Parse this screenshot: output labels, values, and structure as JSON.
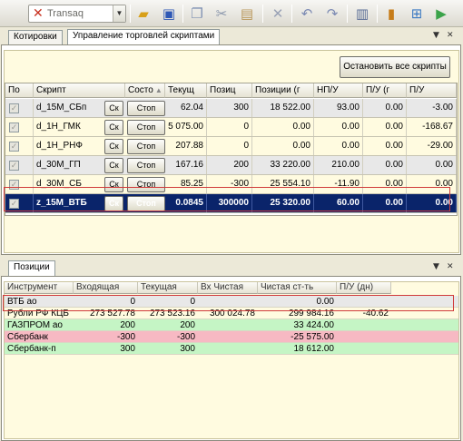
{
  "toolbar": {
    "brand": "Transaq",
    "icons": [
      "open-folder-icon",
      "save-icon",
      "copy-icon",
      "cut-icon",
      "paste-icon",
      "delete-icon",
      "undo-icon",
      "redo-icon",
      "document-icon",
      "chart-icon",
      "tree-icon",
      "play-icon"
    ]
  },
  "tabs_top": [
    "Котировки",
    "Управление торговлей скриптами"
  ],
  "scripts": {
    "stop_all": "Остановить все скрипты",
    "columns": [
      "По",
      "Скрипт",
      "Состо",
      "Текущ",
      "Позиц",
      "Позиции (г",
      "НП/У",
      "П/У (г",
      "П/У"
    ],
    "sk_label": "Ск",
    "stop_label": "Стоп",
    "rows": [
      {
        "name": "d_15M_СБп",
        "cur": "62.04",
        "pos": "300",
        "posv": "18 522.00",
        "npu": "93.00",
        "pug": "0.00",
        "pu": "-3.00"
      },
      {
        "name": "d_1H_ГМК",
        "cur": "5 075.00",
        "pos": "0",
        "posv": "0.00",
        "npu": "0.00",
        "pug": "0.00",
        "pu": "-168.67"
      },
      {
        "name": "d_1H_РНФ",
        "cur": "207.88",
        "pos": "0",
        "posv": "0.00",
        "npu": "0.00",
        "pug": "0.00",
        "pu": "-29.00"
      },
      {
        "name": "d_30M_ГП",
        "cur": "167.16",
        "pos": "200",
        "posv": "33 220.00",
        "npu": "210.00",
        "pug": "0.00",
        "pu": "0.00"
      },
      {
        "name": "d_30M_СБ",
        "cur": "85.25",
        "pos": "-300",
        "posv": "25 554.10",
        "npu": "-11.90",
        "pug": "0.00",
        "pu": "0.00"
      },
      {
        "name": "z_15M_ВТБ",
        "cur": "0.0845",
        "pos": "300000",
        "posv": "25 320.00",
        "npu": "60.00",
        "pug": "0.00",
        "pu": "0.00"
      }
    ]
  },
  "positions": {
    "tab": "Позиции",
    "columns": [
      "Инструмент",
      "Входящая",
      "Текущая",
      "Вх Чистая",
      "Чистая ст-ть",
      "П/У (дн)"
    ],
    "rows": [
      {
        "name": "ВТБ ао",
        "in": "0",
        "cur": "0",
        "innet": "",
        "net": "0.00",
        "pu": "",
        "color": "#e8e8e8"
      },
      {
        "name": "Рубли РФ КЦБ",
        "in": "273 527.78",
        "cur": "273 523.16",
        "innet": "300 024.78",
        "net": "299 984.16",
        "pu": "-40.62",
        "color": "#fffbe0"
      },
      {
        "name": "ГАЗПРОМ ао",
        "in": "200",
        "cur": "200",
        "innet": "",
        "net": "33 424.00",
        "pu": "",
        "color": "#c5f5c5"
      },
      {
        "name": "Сбербанк",
        "in": "-300",
        "cur": "-300",
        "innet": "",
        "net": "-25 575.00",
        "pu": "",
        "color": "#f7b9c3"
      },
      {
        "name": "Сбербанк-п",
        "in": "300",
        "cur": "300",
        "innet": "",
        "net": "18 612.00",
        "pu": "",
        "color": "#c5f5c5"
      }
    ]
  }
}
